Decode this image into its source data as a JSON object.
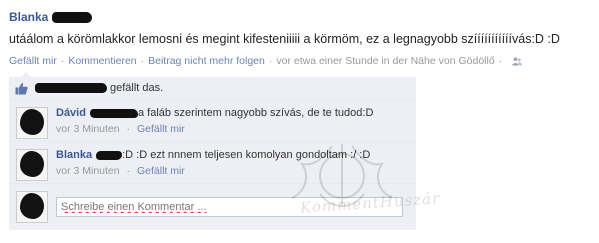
{
  "post": {
    "author": "Blanka",
    "status": "utáálom a körömlakkor lemosni és megint kifesteniiiii a körmöm, ez a legnagyobb szííííííííííívás:D :D",
    "actions": {
      "like": "Gefällt mir",
      "comment": "Kommentieren",
      "unfollow": "Beitrag nicht mehr folgen",
      "time_location": "vor etwa einer Stunde in der Nähe von Gödöllő",
      "separator": "·"
    },
    "privacy_icon": "friends-icon"
  },
  "likes": {
    "icon": "thumbs-up-icon",
    "text": "gefällt das."
  },
  "comments": [
    {
      "author": "Dávid",
      "text": "a faláb szerintem nagyobb szívás, de te tudod:D",
      "time": "vor 3 Minuten",
      "like": "Gefällt mir"
    },
    {
      "author": "Blanka",
      "text": ":D :D ezt nnnem teljesen komolyan gondoltam :/ :D",
      "time": "vor 3 Minuten",
      "like": "Gefällt mir"
    }
  ],
  "compose": {
    "placeholder": "Schreibe einen Kommentar ..."
  },
  "watermark": {
    "text": "KommentHuszár"
  },
  "colors": {
    "link": "#3b5998",
    "meta_link": "#6d84b4",
    "feedback_bg": "#edeff4",
    "meta_text": "#999999"
  }
}
